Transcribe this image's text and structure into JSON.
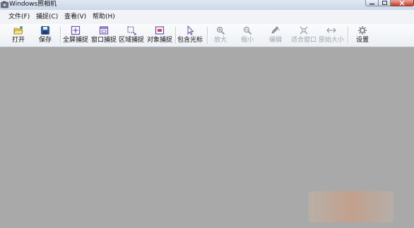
{
  "window": {
    "title": "Windows照相机"
  },
  "menu": [
    {
      "label": "文件(F)"
    },
    {
      "label": "捕捉(C)"
    },
    {
      "label": "查看(V)"
    },
    {
      "label": "帮助(H)"
    }
  ],
  "toolbar": {
    "buttons": [
      {
        "label": "打开",
        "icon": "open-folder-icon",
        "enabled": true
      },
      {
        "label": "保存",
        "icon": "save-disk-icon",
        "enabled": true
      },
      {
        "label": "全屏捕捉",
        "icon": "fullscreen-capture-icon",
        "enabled": true
      },
      {
        "label": "窗口捕捉",
        "icon": "window-capture-icon",
        "enabled": true
      },
      {
        "label": "区域捕捉",
        "icon": "region-capture-icon",
        "enabled": true
      },
      {
        "label": "对象捕捉",
        "icon": "object-capture-icon",
        "enabled": true
      },
      {
        "label": "包含光标",
        "icon": "cursor-icon",
        "enabled": true
      },
      {
        "label": "放大",
        "icon": "zoom-in-icon",
        "enabled": false
      },
      {
        "label": "缩小",
        "icon": "zoom-out-icon",
        "enabled": false
      },
      {
        "label": "编辑",
        "icon": "edit-icon",
        "enabled": false
      },
      {
        "label": "适合窗口",
        "icon": "fit-window-icon",
        "enabled": false
      },
      {
        "label": "原始大小",
        "icon": "original-size-icon",
        "enabled": false
      },
      {
        "label": "设置",
        "icon": "settings-icon",
        "enabled": true
      }
    ]
  },
  "colors": {
    "workspace": "#a9a9a9",
    "toolbar": "#eceff4",
    "accent": "#7b6fc7"
  }
}
